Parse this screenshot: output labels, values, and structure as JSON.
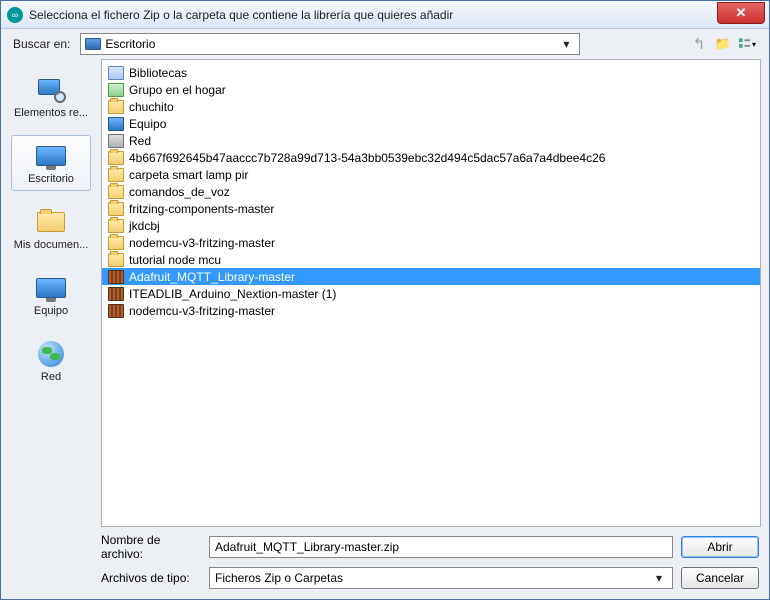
{
  "title": "Selecciona el fichero Zip o la carpeta que contiene la librería que quieres añadir",
  "lookin_label": "Buscar en:",
  "lookin_value": "Escritorio",
  "places": [
    {
      "label": "Elementos re..."
    },
    {
      "label": "Escritorio"
    },
    {
      "label": "Mis documen..."
    },
    {
      "label": "Equipo"
    },
    {
      "label": "Red"
    }
  ],
  "files": [
    {
      "name": "Bibliotecas",
      "icon": "lib"
    },
    {
      "name": "Grupo en el hogar",
      "icon": "group"
    },
    {
      "name": "chuchito",
      "icon": "folder"
    },
    {
      "name": "Equipo",
      "icon": "mon"
    },
    {
      "name": "Red",
      "icon": "net"
    },
    {
      "name": "4b667f692645b47aaccc7b728a99d713-54a3bb0539ebc32d494c5dac57a6a7a4dbee4c26",
      "icon": "folder"
    },
    {
      "name": "carpeta smart lamp pir",
      "icon": "folder"
    },
    {
      "name": "comandos_de_voz",
      "icon": "folder"
    },
    {
      "name": "fritzing-components-master",
      "icon": "folder"
    },
    {
      "name": "jkdcbj",
      "icon": "folder"
    },
    {
      "name": "nodemcu-v3-fritzing-master",
      "icon": "folder"
    },
    {
      "name": "tutorial node mcu",
      "icon": "folder"
    },
    {
      "name": "Adafruit_MQTT_Library-master",
      "icon": "zip",
      "selected": true
    },
    {
      "name": "ITEADLIB_Arduino_Nextion-master (1)",
      "icon": "zip"
    },
    {
      "name": "nodemcu-v3-fritzing-master",
      "icon": "zip"
    }
  ],
  "filename_label": "Nombre de archivo:",
  "filename_value": "Adafruit_MQTT_Library-master.zip",
  "filetype_label": "Archivos de tipo:",
  "filetype_value": "Ficheros Zip o Carpetas",
  "open_label": "Abrir",
  "cancel_label": "Cancelar"
}
